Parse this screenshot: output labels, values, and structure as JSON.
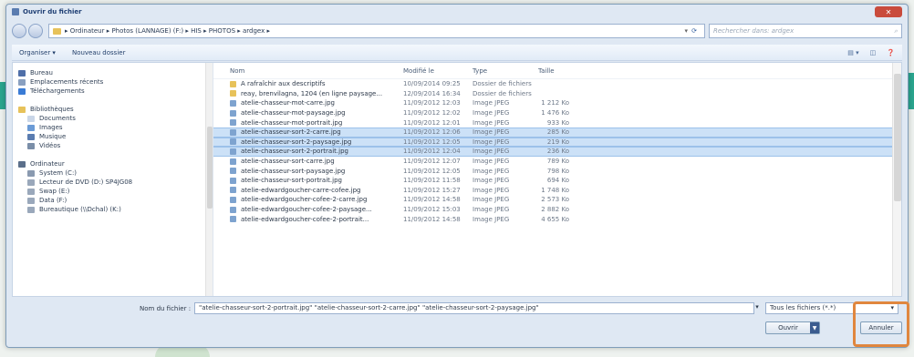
{
  "colors": {
    "highlight": "#e0863e",
    "selection": "#cce1f7",
    "accent": "#2aa58e"
  },
  "window": {
    "title": "Ouvrir du fichier",
    "close_label": "✕"
  },
  "address": {
    "path": "▸ Ordinateur ▸ Photos (LANNAGE) (F:) ▸ HIS ▸ PHOTOS ▸ ardgex ▸",
    "refresh_icon": "refresh-icon",
    "search_placeholder": "Rechercher dans: ardgex"
  },
  "toolbar": {
    "organize_label": "Organiser ▾",
    "new_folder_label": "Nouveau dossier",
    "views_icon": "▤ ▾",
    "pane_icon": "◫",
    "help_icon": "❓"
  },
  "sidebar": {
    "groups": [
      {
        "items": [
          {
            "label": "Bureau",
            "color": "#4f6fa8"
          },
          {
            "label": "Emplacements récents",
            "color": "#8aa0c0"
          },
          {
            "label": "Téléchargements",
            "color": "#3a7bd5"
          }
        ]
      },
      {
        "items": [
          {
            "label": "Bibliothèques",
            "color": "#e7c25a"
          },
          {
            "label": "Documents",
            "color": "#c9d6e8",
            "sub": true
          },
          {
            "label": "Images",
            "color": "#6b9bd6",
            "sub": true
          },
          {
            "label": "Musique",
            "color": "#5a7cb0",
            "sub": true
          },
          {
            "label": "Vidéos",
            "color": "#7a8ea8",
            "sub": true
          }
        ]
      },
      {
        "items": [
          {
            "label": "Ordinateur",
            "color": "#5b6f8a"
          },
          {
            "label": "System (C:)",
            "color": "#8a9ab0",
            "sub": true
          },
          {
            "label": "Lecteur de DVD (D:) SP4JG08",
            "color": "#9aa8bb",
            "sub": true
          },
          {
            "label": "Swap (E:)",
            "color": "#9aa8bb",
            "sub": true
          },
          {
            "label": "Data (F:)",
            "color": "#9aa8bb",
            "sub": true
          },
          {
            "label": "Bureautique (\\\\Dchal) (K:)",
            "color": "#9aa8bb",
            "sub": true
          }
        ]
      }
    ]
  },
  "filelist": {
    "headers": {
      "name": "Nom",
      "date": "Modifié le",
      "type": "Type",
      "size": "Taille"
    },
    "rows": [
      {
        "name": "A rafraîchir aux descriptifs",
        "date": "10/09/2014 09:25",
        "type": "Dossier de fichiers",
        "size": "",
        "icon_color": "#e7c25a",
        "selected": false
      },
      {
        "name": "reay, brenvilagna, 1204 (en ligne paysage...",
        "date": "12/09/2014 16:34",
        "type": "Dossier de fichiers",
        "size": "",
        "icon_color": "#e7c25a",
        "selected": false
      },
      {
        "name": "atelie-chasseur-mot-carre.jpg",
        "date": "11/09/2012 12:03",
        "type": "Image JPEG",
        "size": "1 212 Ko",
        "icon_color": "#7ea3cf",
        "selected": false
      },
      {
        "name": "atelie-chasseur-mot-paysage.jpg",
        "date": "11/09/2012 12:02",
        "type": "Image JPEG",
        "size": "1 476 Ko",
        "icon_color": "#7ea3cf",
        "selected": false
      },
      {
        "name": "atelie-chasseur-mot-portrait.jpg",
        "date": "11/09/2012 12:01",
        "type": "Image JPEG",
        "size": "933 Ko",
        "icon_color": "#7ea3cf",
        "selected": false
      },
      {
        "name": "atelie-chasseur-sort-2-carre.jpg",
        "date": "11/09/2012 12:06",
        "type": "Image JPEG",
        "size": "285 Ko",
        "icon_color": "#7ea3cf",
        "selected": true
      },
      {
        "name": "atelie-chasseur-sort-2-paysage.jpg",
        "date": "11/09/2012 12:05",
        "type": "Image JPEG",
        "size": "219 Ko",
        "icon_color": "#7ea3cf",
        "selected": true
      },
      {
        "name": "atelie-chasseur-sort-2-portrait.jpg",
        "date": "11/09/2012 12:04",
        "type": "Image JPEG",
        "size": "236 Ko",
        "icon_color": "#7ea3cf",
        "selected": true
      },
      {
        "name": "atelie-chasseur-sort-carre.jpg",
        "date": "11/09/2012 12:07",
        "type": "Image JPEG",
        "size": "789 Ko",
        "icon_color": "#7ea3cf",
        "selected": false
      },
      {
        "name": "atelie-chasseur-sort-paysage.jpg",
        "date": "11/09/2012 12:05",
        "type": "Image JPEG",
        "size": "798 Ko",
        "icon_color": "#7ea3cf",
        "selected": false
      },
      {
        "name": "atelie-chasseur-sort-portrait.jpg",
        "date": "11/09/2012 11:58",
        "type": "Image JPEG",
        "size": "694 Ko",
        "icon_color": "#7ea3cf",
        "selected": false
      },
      {
        "name": "atelie-edwardgoucher-carre-cofee.jpg",
        "date": "11/09/2012 15:27",
        "type": "Image JPEG",
        "size": "1 748 Ko",
        "icon_color": "#7ea3cf",
        "selected": false
      },
      {
        "name": "atelie-edwardgoucher-cofee-2-carre.jpg",
        "date": "11/09/2012 14:58",
        "type": "Image JPEG",
        "size": "2 573 Ko",
        "icon_color": "#7ea3cf",
        "selected": false
      },
      {
        "name": "atelie-edwardgoucher-cofee-2-paysage...",
        "date": "11/09/2012 15:03",
        "type": "Image JPEG",
        "size": "2 882 Ko",
        "icon_color": "#7ea3cf",
        "selected": false
      },
      {
        "name": "atelie-edwardgoucher-cofee-2-portrait...",
        "date": "11/09/2012 14:58",
        "type": "Image JPEG",
        "size": "4 655 Ko",
        "icon_color": "#7ea3cf",
        "selected": false
      }
    ]
  },
  "footer": {
    "filename_label": "Nom du fichier :",
    "filename_value": "\"atelie-chasseur-sort-2-portrait.jpg\" \"atelie-chasseur-sort-2-carre.jpg\" \"atelie-chasseur-sort-2-paysage.jpg\"",
    "filter_value": "Tous les fichiers (*.*)",
    "open_label": "Ouvrir",
    "cancel_label": "Annuler"
  }
}
